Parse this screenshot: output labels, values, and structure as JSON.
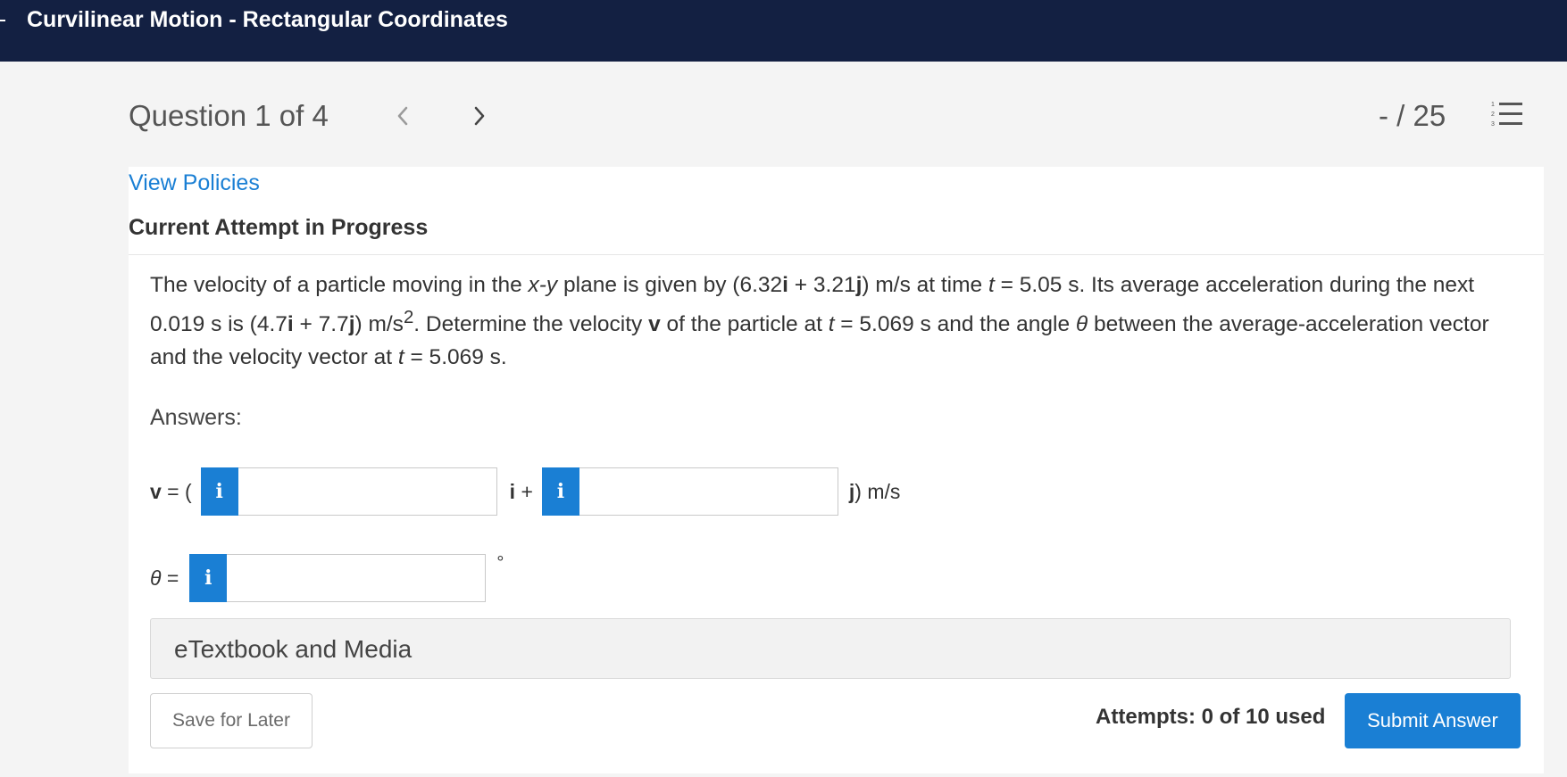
{
  "header": {
    "title": "Curvilinear Motion - Rectangular Coordinates"
  },
  "question_nav": {
    "label": "Question 1 of 4",
    "score": "- / 25",
    "prev_icon": "chevron-left-icon",
    "next_icon": "chevron-right-icon",
    "list_icon": "numbered-list-icon"
  },
  "links": {
    "view_policies": "View Policies"
  },
  "status": {
    "heading": "Current Attempt in Progress"
  },
  "question": {
    "p1": "The velocity of a particle moving in the ",
    "xy": "x-y",
    "p2": " plane is given by (6.32",
    "i1": "i",
    "p3": " + 3.21",
    "j1": "j",
    "p4": ") m/s at time ",
    "t1": "t",
    "p5": " = 5.05 s. Its average acceleration during the next 0.019 s is (4.7",
    "i2": "i",
    "p6": " + 7.7",
    "j2": "j",
    "p7": ") m/s",
    "sup": "2",
    "p8": ". Determine the velocity ",
    "v": "v",
    "p9": " of the particle at ",
    "t2": "t",
    "p10": " = 5.069 s and the angle ",
    "theta": "θ",
    "p11": " between the average-acceleration vector and the velocity vector at ",
    "t3": "t",
    "p12": " = 5.069 s."
  },
  "answers": {
    "label": "Answers:",
    "v_label_v": "v",
    "v_label_rest": " = (",
    "i_label": "i",
    "i_plus": " +",
    "j_label": "j",
    "j_units": ") m/s",
    "theta_label": "θ",
    "theta_eq": " =",
    "degree": "°",
    "info_glyph": "i",
    "vx_value": "",
    "vy_value": "",
    "theta_value": ""
  },
  "etextbook": {
    "label": "eTextbook and Media"
  },
  "footer": {
    "save_label": "Save for Later",
    "attempts": "Attempts: 0 of 10 used",
    "submit_label": "Submit Answer"
  },
  "colors": {
    "topbar": "#132042",
    "accent": "#1a7fd4",
    "background": "#f4f4f4"
  }
}
